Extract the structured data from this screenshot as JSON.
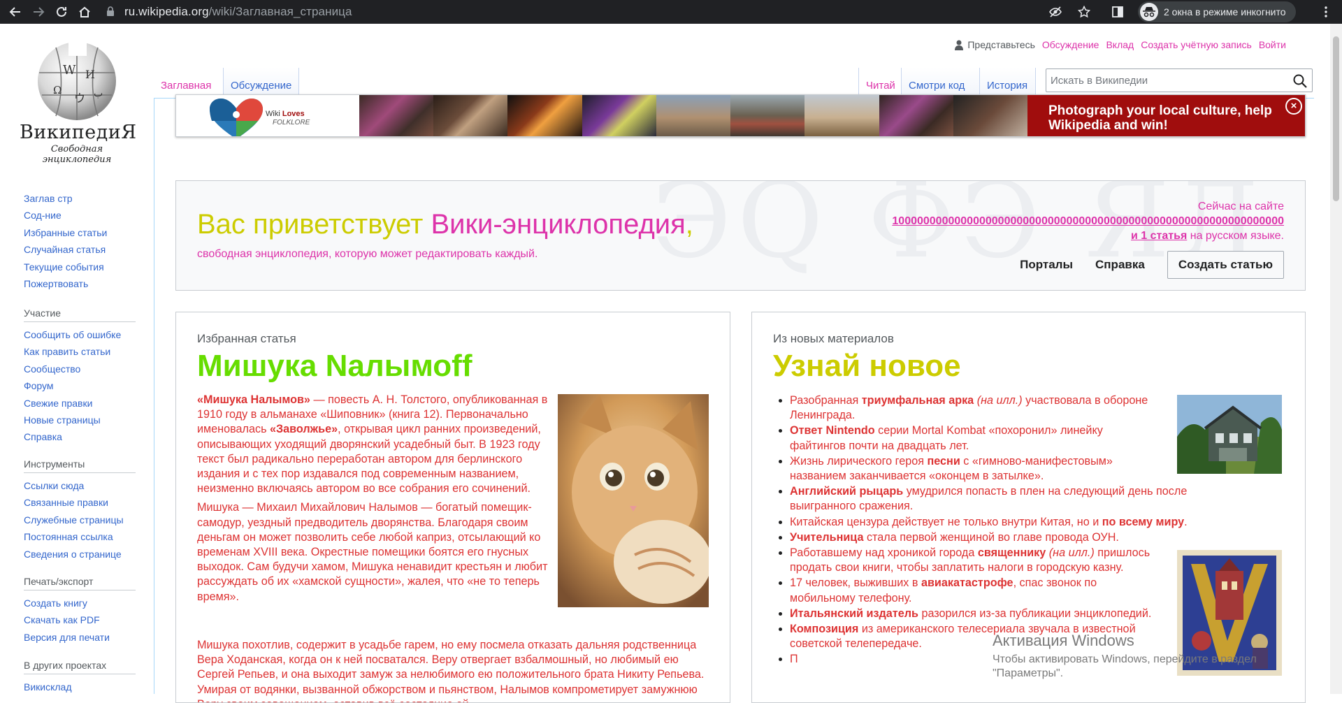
{
  "browser": {
    "url_host": "ru.wikipedia.org",
    "url_path": "/wiki/Заглавная_страница",
    "incognito_label": "2 окна в режиме инкогнито"
  },
  "logo": {
    "wordmark": "ВикипедиЯ",
    "tagline": "Свободная энциклопедия"
  },
  "sidebar": {
    "main": [
      "Заглав стр",
      "Сод-ние",
      "Избранные статьи",
      "Случайная статья",
      "Текущие события",
      "Пожертвовать"
    ],
    "participation_heading": "Участие",
    "participation": [
      "Сообщить об ошибке",
      "Как править статьи",
      "Сообщество",
      "Форум",
      "Свежие правки",
      "Новые страницы",
      "Справка"
    ],
    "tools_heading": "Инструменты",
    "tools": [
      "Ссылки сюда",
      "Связанные правки",
      "Служебные страницы",
      "Постоянная ссылка",
      "Сведения о странице"
    ],
    "print_heading": "Печать/экспорт",
    "print": [
      "Создать книгу",
      "Скачать как PDF",
      "Версия для печати"
    ],
    "other_heading": "В других проектах",
    "other": [
      "Викисклад"
    ]
  },
  "personal_tools": {
    "anon": "Представьтесь",
    "talk": "Обсуждение",
    "contributions": "Вклад",
    "create_account": "Создать учётную запись",
    "login": "Войти"
  },
  "tabs": {
    "main": "Заглавная",
    "discussion": "Обсуждение",
    "read": "Читай",
    "view_source": "Смотри код",
    "history": "История"
  },
  "search": {
    "placeholder": "Искать в Википедии"
  },
  "banner": {
    "logo_line1": "Wiki",
    "logo_line1_b": "Loves",
    "logo_line2": "FOLKLORE",
    "cta": "Photograph your local culture, help Wikipedia and win!",
    "close": "×"
  },
  "welcome": {
    "greet_a": "Вас приветствует ",
    "greet_b": "Вики-энциклопедия",
    "greet_c": ",",
    "subtitle": "свободная энциклопедия, которую может редактировать каждый.",
    "stats_line1": "Сейчас на сайте",
    "stats_number": "100000000000000000000000000000000000000000000000000000000000000",
    "stats_and": "и 1 статья",
    "stats_tail": " на русском языке.",
    "portals": "Порталы",
    "help": "Справка",
    "create": "Создать статью",
    "bg": "ЭQ ФЭ ЯД ИЕ"
  },
  "featured": {
    "kicker": "Избранная статья",
    "title": "Мишука Nалымоff",
    "p1_b1": "«Мишука Налымов»",
    "p1_t1": " — повесть А. Н. Толстого, опубликованная в 1910 году в альманахе «Шиповник» (книга 12). Первоначально именовалась ",
    "p1_b2": "«Заволжье»",
    "p1_t2": ", открывая цикл ранних произведений, описывающих уходящий дворянский усадебный быт. В 1923 году текст был радикально переработан автором для берлинского издания и с тех пор издавался под современным названием, неизменно включаясь автором во все собрания его сочинений.",
    "p2": "Мишука — Михаил Михайлович Налымов — богатый помещик-самодур, уездный предводитель дворянства. Благодаря своим деньгам он может позволить себе любой каприз, отсылающий ко временам XVIII века. Окрестные помещики боятся его гнусных выходок. Сам будучи хамом, Мишука ненавидит крестьян и любит рассуждать об их «хамской сущности», жалея, что «не то теперь время».",
    "p3": "Мишука похотлив, содержит в усадьбе гарем, но ему посмела отказать дальняя родственница Вера Ходанская, когда он к ней посватался. Веру отвергает взбалмошный, но любимый ею Сергей Репьев, и она выходит замуж за нелюбимого ею положительного брата Никиту Репьева. Умирая от водянки, вызванной обжорством и пьянством, Налымов компрометирует замужнюю Веру своим завещанием, оставив всё состояние ей"
  },
  "dyk": {
    "kicker": "Из новых материалов",
    "title": "Узнай новое",
    "items": [
      [
        {
          "t": "Разобранная "
        },
        {
          "t": "триумфальная арка",
          "b": true
        },
        {
          "t": " "
        },
        {
          "t": "(на илл.)",
          "i": true
        },
        {
          "t": " участвовала в обороне Ленинграда."
        }
      ],
      [
        {
          "t": "Ответ Nintendo",
          "b": true
        },
        {
          "t": " серии Mortal Kombat «похоронил» линейку файтингов почти на двадцать лет."
        }
      ],
      [
        {
          "t": "Жизнь лирического героя "
        },
        {
          "t": "песни",
          "b": true
        },
        {
          "t": " с «гимново-манифестовым» названием заканчивается «оконцем в затылке»."
        }
      ],
      [
        {
          "t": "Английский рыцарь",
          "b": true
        },
        {
          "t": " умудрился попасть в плен на следующий день после выигранного сражения."
        }
      ],
      [
        {
          "t": "Китайская цензура действует не только внутри Китая, но и "
        },
        {
          "t": "по всему миру",
          "b": true
        },
        {
          "t": "."
        }
      ],
      [
        {
          "t": "Учительница",
          "b": true
        },
        {
          "t": " стала первой женщиной во главе провода ОУН."
        }
      ],
      [
        {
          "t": "Работавшему над хроникой города "
        },
        {
          "t": "священнику",
          "b": true
        },
        {
          "t": " "
        },
        {
          "t": "(на илл.)",
          "i": true
        },
        {
          "t": " пришлось продать свои книги, чтобы заплатить налоги в городскую казну."
        }
      ],
      [
        {
          "t": "17 человек, выживших в "
        },
        {
          "t": "авиакатастрофе",
          "b": true
        },
        {
          "t": ", спас звонок по мобильному телефону."
        }
      ],
      [
        {
          "t": "Итальянский издатель",
          "b": true
        },
        {
          "t": " разорился из-за публикации энциклопедий."
        }
      ],
      [
        {
          "t": "Композиция",
          "b": true
        },
        {
          "t": " из американского телесериала звучала в известной советской телепередаче."
        }
      ],
      [
        {
          "t": "П"
        }
      ]
    ]
  },
  "activation": {
    "title": "Активация Windows",
    "body": "Чтобы активировать Windows, перейдите в раздел \"Параметры\"."
  },
  "colors": {
    "link": "#3366cc",
    "pink": "#dd33aa",
    "red": "#dd3333",
    "green": "#66cc00",
    "yellow": "#cccc00",
    "banner": "#a00d0d"
  }
}
